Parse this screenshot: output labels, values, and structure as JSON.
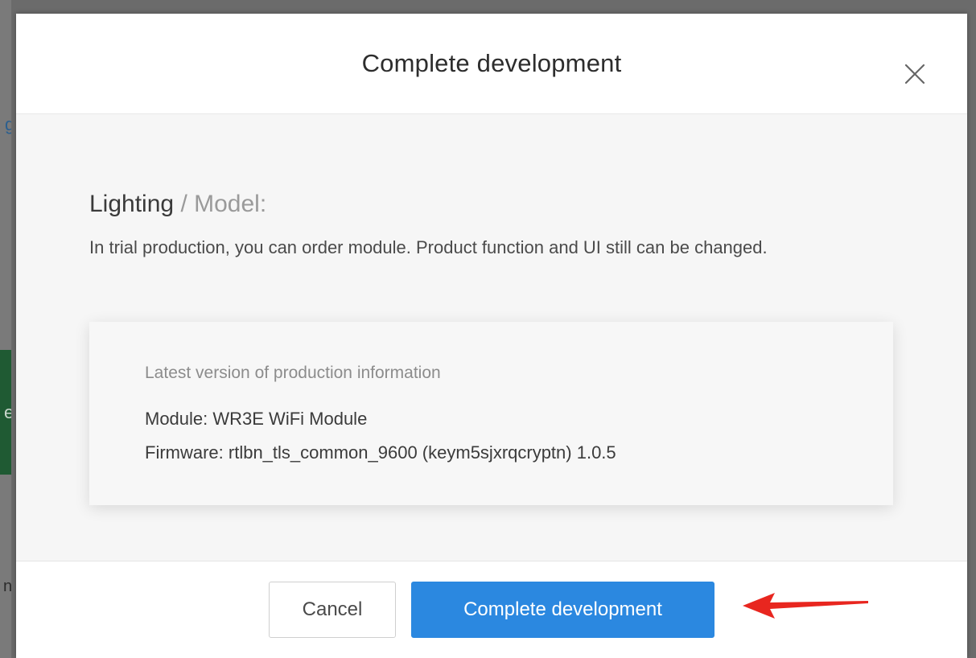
{
  "background": {
    "link_fragment": "g",
    "green_fragment": "e",
    "text_fragment": "n"
  },
  "modal": {
    "title": "Complete development",
    "close_icon": "close-icon",
    "breadcrumb": {
      "category": "Lighting",
      "separator": "/",
      "model_label": "Model:"
    },
    "description": "In trial production, you can order module. Product function and UI still can be changed.",
    "info": {
      "heading": "Latest version of production information",
      "module": "Module: WR3E WiFi Module",
      "firmware": "Firmware: rtlbn_tls_common_9600 (keym5sjxrqcryptn) 1.0.5"
    },
    "footer": {
      "cancel_label": "Cancel",
      "primary_label": "Complete development"
    }
  },
  "colors": {
    "primary": "#2b88e0",
    "annotation_arrow": "#e8261f"
  }
}
